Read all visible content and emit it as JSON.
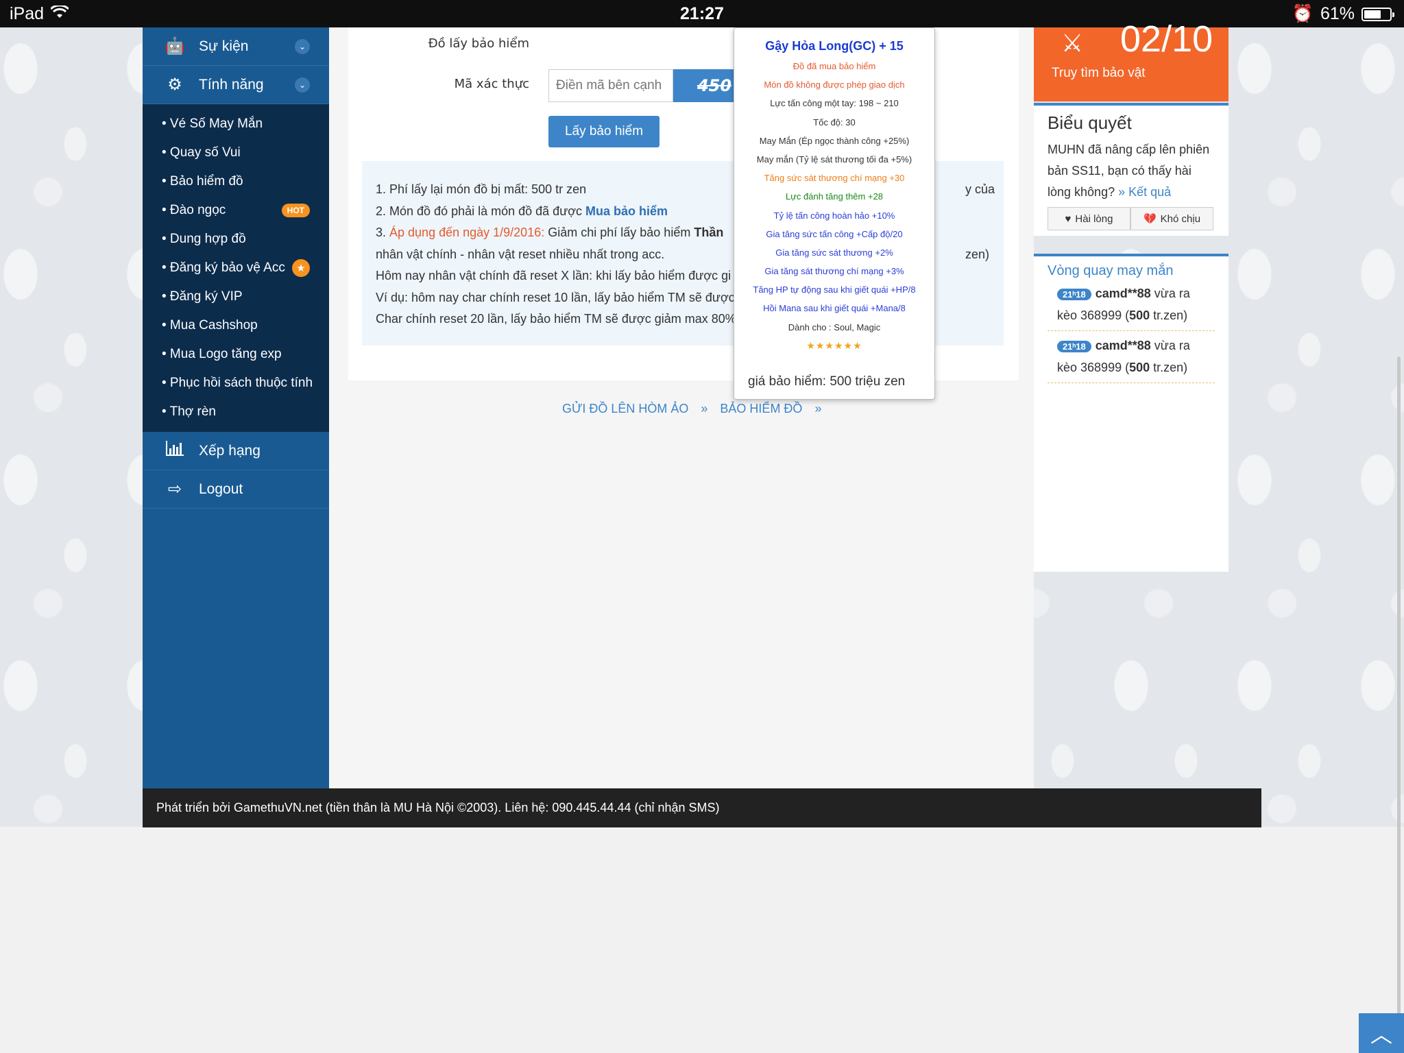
{
  "status": {
    "device": "iPad",
    "time": "21:27",
    "battery": "61%",
    "battery_level": 0.61
  },
  "sidebar": {
    "top_items": [
      {
        "label": "Sự kiện",
        "icon": "android-icon"
      },
      {
        "label": "Tính năng",
        "icon": "gears-icon"
      }
    ],
    "submenu": [
      "• Vé Số May Mắn",
      "• Quay số Vui",
      "• Bảo hiểm đồ",
      "• Đào ngọc",
      "• Dung hợp đồ",
      "• Đăng ký bảo vệ Acc",
      "• Đăng ký VIP",
      "• Mua Cashshop",
      "• Mua Logo tăng exp",
      "• Phục hồi sách thuộc tính",
      "• Thợ rèn"
    ],
    "hot_badge": "HOT",
    "bottom_items": [
      {
        "label": "Xếp hạng",
        "icon": "bar-chart-icon"
      },
      {
        "label": "Logout",
        "icon": "sign-out-icon"
      }
    ]
  },
  "form": {
    "item_label": "Đồ lấy bảo hiểm",
    "captcha_label": "Mã xác thực",
    "captcha_placeholder": "Điền mã bên cạnh",
    "captcha_code": "450",
    "submit": "Lấy bảo hiểm"
  },
  "info": {
    "l1": "1. Phí lấy lại món đồ bị mất: 500 tr zen",
    "l2_pre": "2. Món đồ đó phải là món đồ đã được ",
    "l2_link": "Mua bảo hiểm",
    "l3_num": "3. ",
    "l3_red": "Áp dụng đến ngày 1/9/2016:",
    "l3_text": " Giảm chi phí lấy bảo hiểm ",
    "l3_bold": "Thần",
    "l3_tail": "y của",
    "l4": "nhân vật chính - nhân vật reset nhiều nhất trong acc.",
    "l5": "Hôm nay nhân vật chính đã reset X lần: khi lấy bảo hiểm được gi",
    "l5_tail": "zen)",
    "l6": "Ví dụ: hôm nay char chính reset 10 lần, lấy bảo hiểm TM sẽ được",
    "l7": "Char chính reset 20 lần, lấy bảo hiểm TM sẽ được giảm max 80%"
  },
  "breadcrumb": {
    "a": "GỬI ĐỒ LÊN HÒM ẢO",
    "b": "BẢO HIỂM ĐỒ",
    "sep": "»"
  },
  "tooltip": {
    "title": "Gậy Hỏa Long(GC) + 15",
    "lines": [
      {
        "text": "Đồ đã mua bảo hiểm",
        "color": "red"
      },
      {
        "text": "Món đồ không được phép giao dịch",
        "color": "red"
      },
      {
        "text": "Lực tấn công một tay: 198 ~ 210",
        "color": "gray"
      },
      {
        "text": "Tốc độ: 30",
        "color": "gray"
      },
      {
        "text": "May Mắn (Ép ngọc thành công +25%)",
        "color": "gray"
      },
      {
        "text": "May mắn (Tỷ lệ sát thương tối đa +5%)",
        "color": "gray"
      },
      {
        "text": "Tăng sức sát thương chí mạng +30",
        "color": "orange"
      },
      {
        "text": "Lực đánh tăng thêm +28",
        "color": "green"
      },
      {
        "text": "Tỷ lệ tấn công hoàn hảo +10%",
        "color": "blue"
      },
      {
        "text": "Gia tăng sức tấn công +Cấp độ/20",
        "color": "blue"
      },
      {
        "text": "Gia tăng sức sát thương +2%",
        "color": "blue"
      },
      {
        "text": "Gia tăng sát thương chí mạng +3%",
        "color": "blue"
      },
      {
        "text": "Tăng HP tự động sau khi giết quái +HP/8",
        "color": "blue"
      },
      {
        "text": "Hồi Mana sau khi giết quái +Mana/8",
        "color": "blue"
      },
      {
        "text": "Dành cho : Soul, Magic",
        "color": "gray"
      }
    ],
    "stars": "★★★★★★",
    "price": "giá bảo hiểm: 500 triệu zen"
  },
  "event_card": {
    "date": "02/10",
    "label": "Truy tìm bảo vật"
  },
  "poll": {
    "heading": "Biểu quyết",
    "question": "MUHN đã nâng cấp lên phiên bản SS11, bạn có thấy hài lòng không?",
    "result_link": "» Kết quả",
    "btn_yes": "Hài lòng",
    "btn_no": "Khó chịu"
  },
  "wheel": {
    "heading": "Vòng quay may mắn",
    "entries": [
      {
        "time": "21ʰ18",
        "user": "camd**88",
        "pre": " vừa ra kèo 368999 (",
        "amount": "500",
        "post": " tr.zen)"
      },
      {
        "time": "21ʰ18",
        "user": "camd**88",
        "pre": " vừa ra kèo 368999 (",
        "amount": "500",
        "post": " tr.zen)"
      }
    ]
  },
  "footer": "Phát triển bởi GamethuVN.net (tiền thân là MU Hà Nội ©2003). Liên hệ: 090.445.44.44 (chỉ nhận SMS)",
  "colors": {
    "sidebar": "#1a5a92",
    "submenu": "#0c2c4c",
    "accent": "#3d85c8",
    "orange": "#f2662a"
  }
}
